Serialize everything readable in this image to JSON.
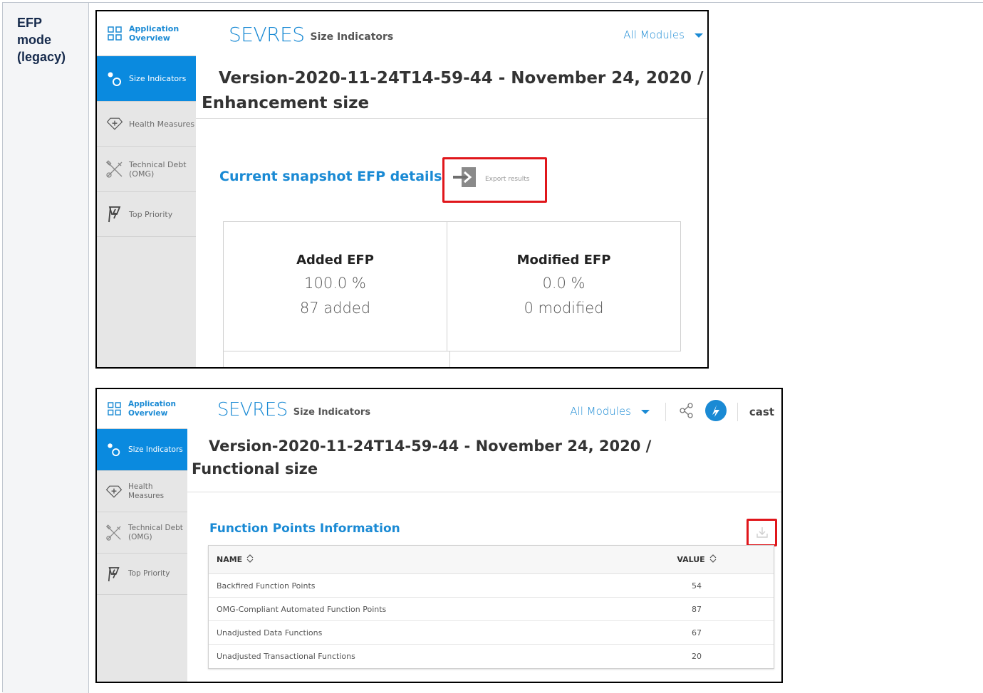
{
  "row_label": [
    "EFP",
    "mode",
    "(legacy)"
  ],
  "sidebar": {
    "items": [
      {
        "label": "Application Overview",
        "icon": "grid-icon"
      },
      {
        "label": "Size Indicators",
        "icon": "size-indicators-icon"
      },
      {
        "label": "Health Measures",
        "icon": "health-diamond-icon"
      },
      {
        "label": "Technical Debt (OMG)",
        "icon": "tools-icon"
      },
      {
        "label": "Top Priority",
        "icon": "top-priority-icon"
      }
    ]
  },
  "screen1": {
    "brand": "SEVRES",
    "brand_sub": "Size Indicators",
    "modules": "All Modules",
    "version_line1": "Version-2020-11-24T14-59-44 - November 24, 2020 /",
    "version_line2": "Enhancement size",
    "section_title": "Current snapshot EFP details",
    "export_label": "Export results",
    "cards": [
      {
        "title": "Added EFP",
        "value": "100.0 %",
        "sub": "87 added"
      },
      {
        "title": "Modified EFP",
        "value": "0.0 %",
        "sub": "0 modified"
      }
    ]
  },
  "screen2": {
    "brand": "SEVRES",
    "brand_sub": "Size Indicators",
    "modules": "All Modules",
    "user": "cast",
    "version_line1": "Version-2020-11-24T14-59-44 - November 24, 2020 /",
    "version_line2": "Functional size",
    "section_title": "Function Points Information",
    "table": {
      "columns": [
        "NAME",
        "VALUE"
      ],
      "rows": [
        {
          "name": "Backfired Function Points",
          "value": "54"
        },
        {
          "name": "OMG-Compliant Automated Function Points",
          "value": "87"
        },
        {
          "name": "Unadjusted Data Functions",
          "value": "67"
        },
        {
          "name": "Unadjusted Transactional Functions",
          "value": "20"
        }
      ]
    }
  },
  "colors": {
    "accent": "#1a8ad4",
    "active_sidebar": "#0a8adf",
    "highlight": "#e0161b"
  }
}
